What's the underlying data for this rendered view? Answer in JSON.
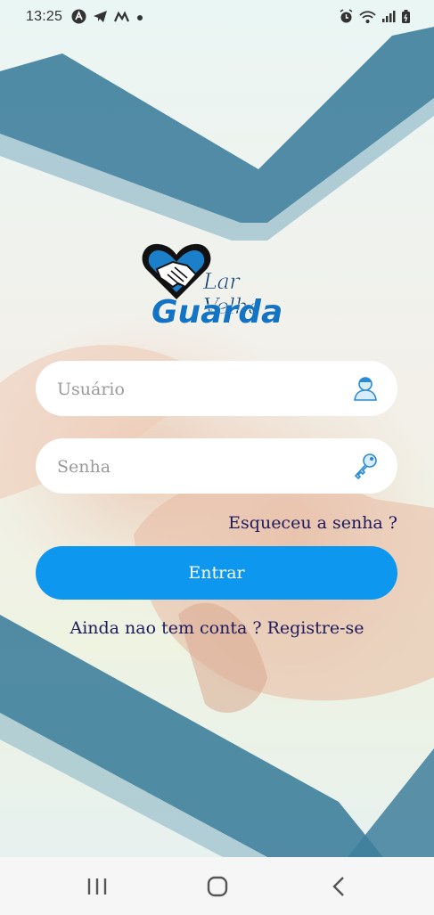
{
  "status_bar": {
    "time": "13:25",
    "left_icons": [
      "app-a-icon",
      "telegram-icon",
      "m-icon",
      "dot-icon"
    ],
    "right_icons": [
      "alarm-icon",
      "wifi-icon",
      "signal-icon",
      "battery-icon"
    ]
  },
  "logo": {
    "line1": "Lar Velha",
    "line2": "Guarda"
  },
  "form": {
    "username_placeholder": "Usuário",
    "username_value": "",
    "password_placeholder": "Senha",
    "password_value": "",
    "forgot_label": "Esqueceu a senha ?",
    "login_label": "Entrar",
    "register_label": "Ainda nao tem conta ? Registre-se"
  },
  "colors": {
    "primary": "#0d97ef",
    "link": "#1d1a5e",
    "logo_blue": "#1473c2",
    "ribbon": "#3f7f9c"
  },
  "navbar": {
    "icons": [
      "recent-apps-icon",
      "home-icon",
      "back-icon"
    ]
  }
}
